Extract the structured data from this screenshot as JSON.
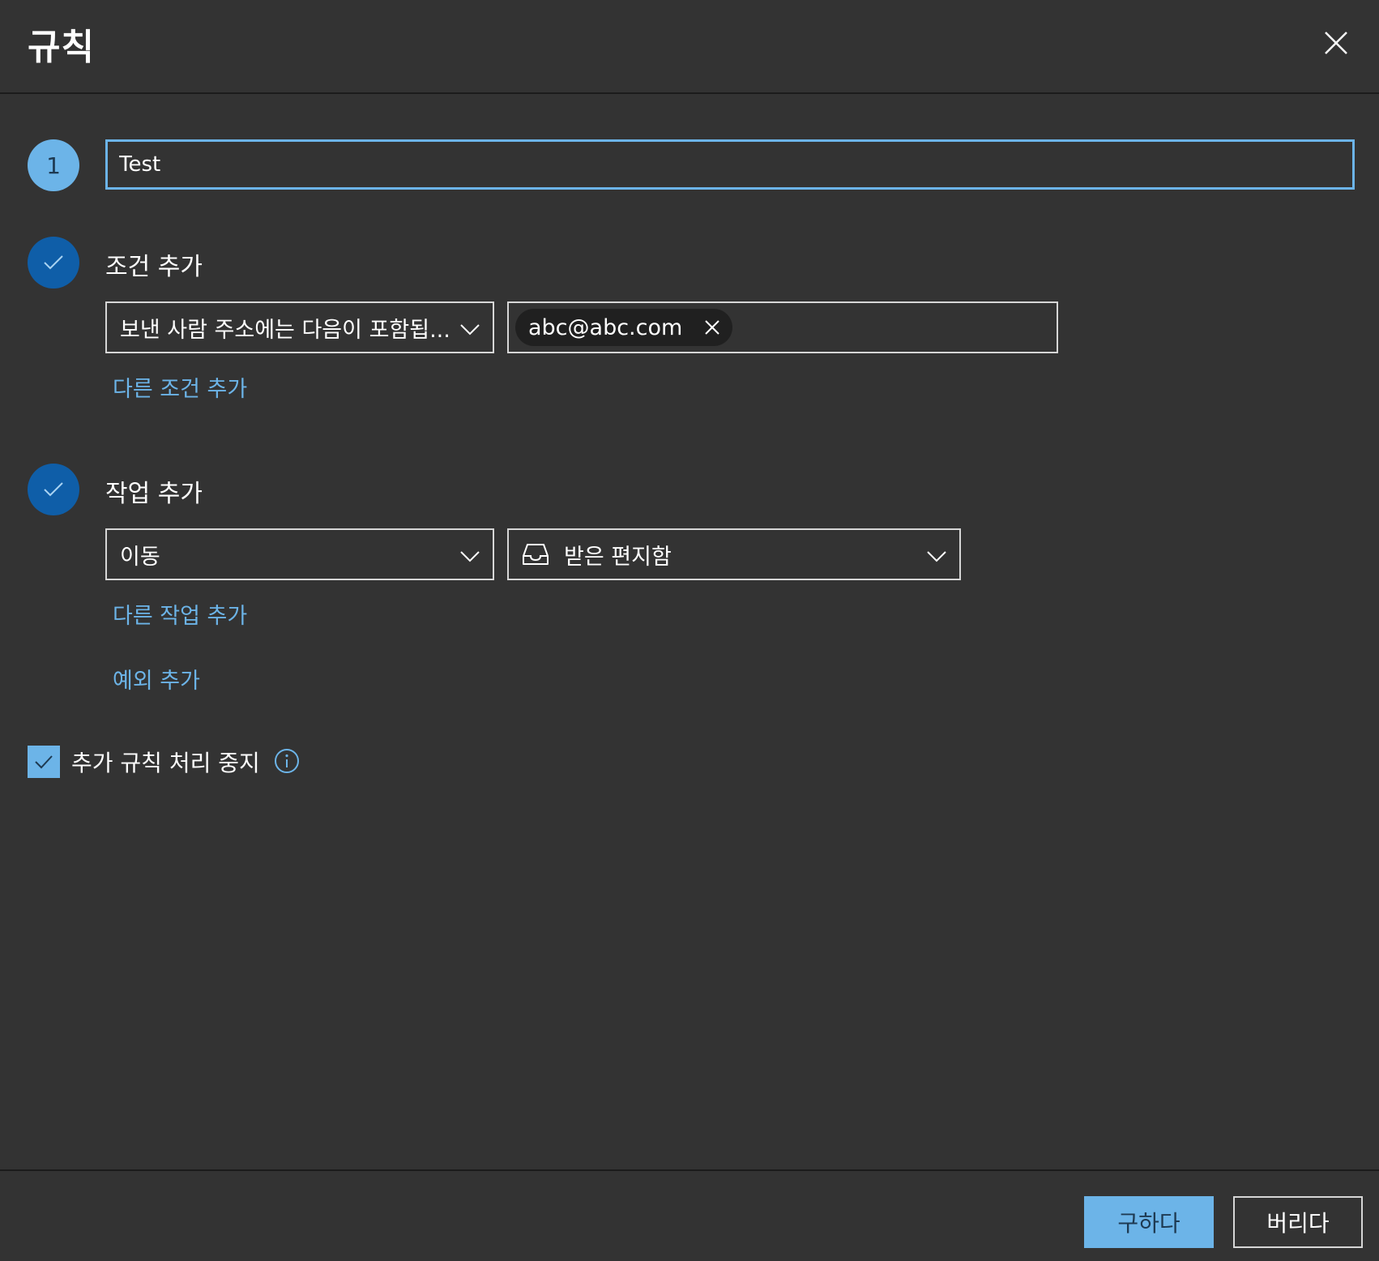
{
  "dialog": {
    "title": "규칙",
    "close_icon": "close-icon"
  },
  "step1": {
    "number": "1",
    "rule_name_value": "Test"
  },
  "conditions": {
    "label": "조건 추가",
    "condition_select": "보낸 사람 주소에는 다음이 포함됩...",
    "tag": "abc@abc.com",
    "add_link": "다른 조건 추가"
  },
  "actions": {
    "label": "작업 추가",
    "action_select": "이동",
    "folder_select": "받은 편지함",
    "folder_icon": "inbox-icon",
    "add_link": "다른 작업 추가",
    "exception_link": "예외 추가"
  },
  "options": {
    "stop_processing_label": "추가 규칙 처리 중지",
    "stop_processing_checked": true
  },
  "footer": {
    "save_label": "구하다",
    "discard_label": "버리다"
  },
  "colors": {
    "background": "#333333",
    "accent": "#6cb4e8",
    "step_done": "#0f5ea8"
  }
}
